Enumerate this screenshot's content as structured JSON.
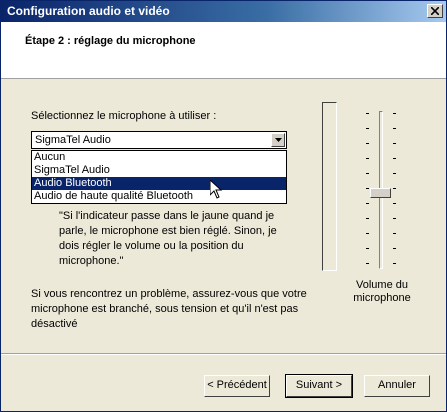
{
  "window": {
    "title": "Configuration audio et vidéo"
  },
  "header": {
    "step_title": "Étape 2 : réglage du microphone"
  },
  "microphone": {
    "prompt": "Sélectionnez le microphone à utiliser :",
    "selected": "SigmaTel Audio",
    "options": [
      "Aucun",
      "SigmaTel Audio",
      "Audio Bluetooth",
      "Audio de haute qualité Bluetooth"
    ],
    "highlighted_option": "Audio Bluetooth"
  },
  "hint": "\"Si l'indicateur passe dans le jaune quand je parle, le microphone est bien réglé. Sinon, je dois régler le volume ou la position du microphone.\"",
  "note": "Si vous rencontrez un problème, assurez-vous que votre microphone est branché, sous tension et qu'il n'est pas désactivé",
  "volume": {
    "label_line1": "Volume du",
    "label_line2": "microphone",
    "level": 0.5
  },
  "level_meter": {
    "level": 0
  },
  "buttons": {
    "back": "< Précédent",
    "next": "Suivant >",
    "cancel": "Annuler"
  },
  "icons": {
    "close": "close-icon",
    "dropdown": "chevron-down-icon",
    "cursor": "mouse-pointer-icon"
  }
}
